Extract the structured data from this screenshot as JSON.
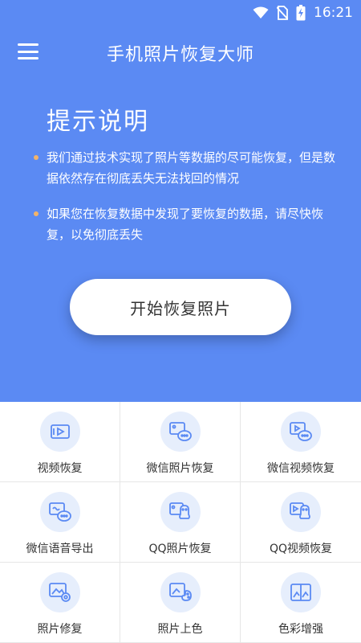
{
  "status_bar": {
    "time": "16:21",
    "icons": [
      "wifi-icon",
      "no-sim-icon",
      "battery-charging-icon"
    ]
  },
  "app_bar": {
    "title": "手机照片恢复大师",
    "menu_icon": "menu-icon"
  },
  "tips": {
    "title": "提示说明",
    "items": [
      "我们通过技术实现了照片等数据的尽可能恢复，但是数据依然存在彻底丢失无法找回的情况",
      "如果您在恢复数据中发现了要恢复的数据，请尽快恢复，以免彻底丢失"
    ]
  },
  "start_button": {
    "label": "开始恢复照片"
  },
  "features": [
    {
      "label": "视频恢复",
      "icon": "video-icon"
    },
    {
      "label": "微信照片恢复",
      "icon": "wechat-photo-icon"
    },
    {
      "label": "微信视频恢复",
      "icon": "wechat-video-icon"
    },
    {
      "label": "微信语音导出",
      "icon": "wechat-voice-icon"
    },
    {
      "label": "QQ照片恢复",
      "icon": "qq-photo-icon"
    },
    {
      "label": "QQ视频恢复",
      "icon": "qq-video-icon"
    },
    {
      "label": "照片修复",
      "icon": "photo-repair-icon"
    },
    {
      "label": "照片上色",
      "icon": "photo-color-icon"
    },
    {
      "label": "色彩增强",
      "icon": "color-enhance-icon"
    }
  ],
  "colors": {
    "primary": "#5b8af3",
    "accent_dot": "#f2b36a",
    "icon_bg": "#e6eefc",
    "icon_stroke": "#5b8af3"
  }
}
